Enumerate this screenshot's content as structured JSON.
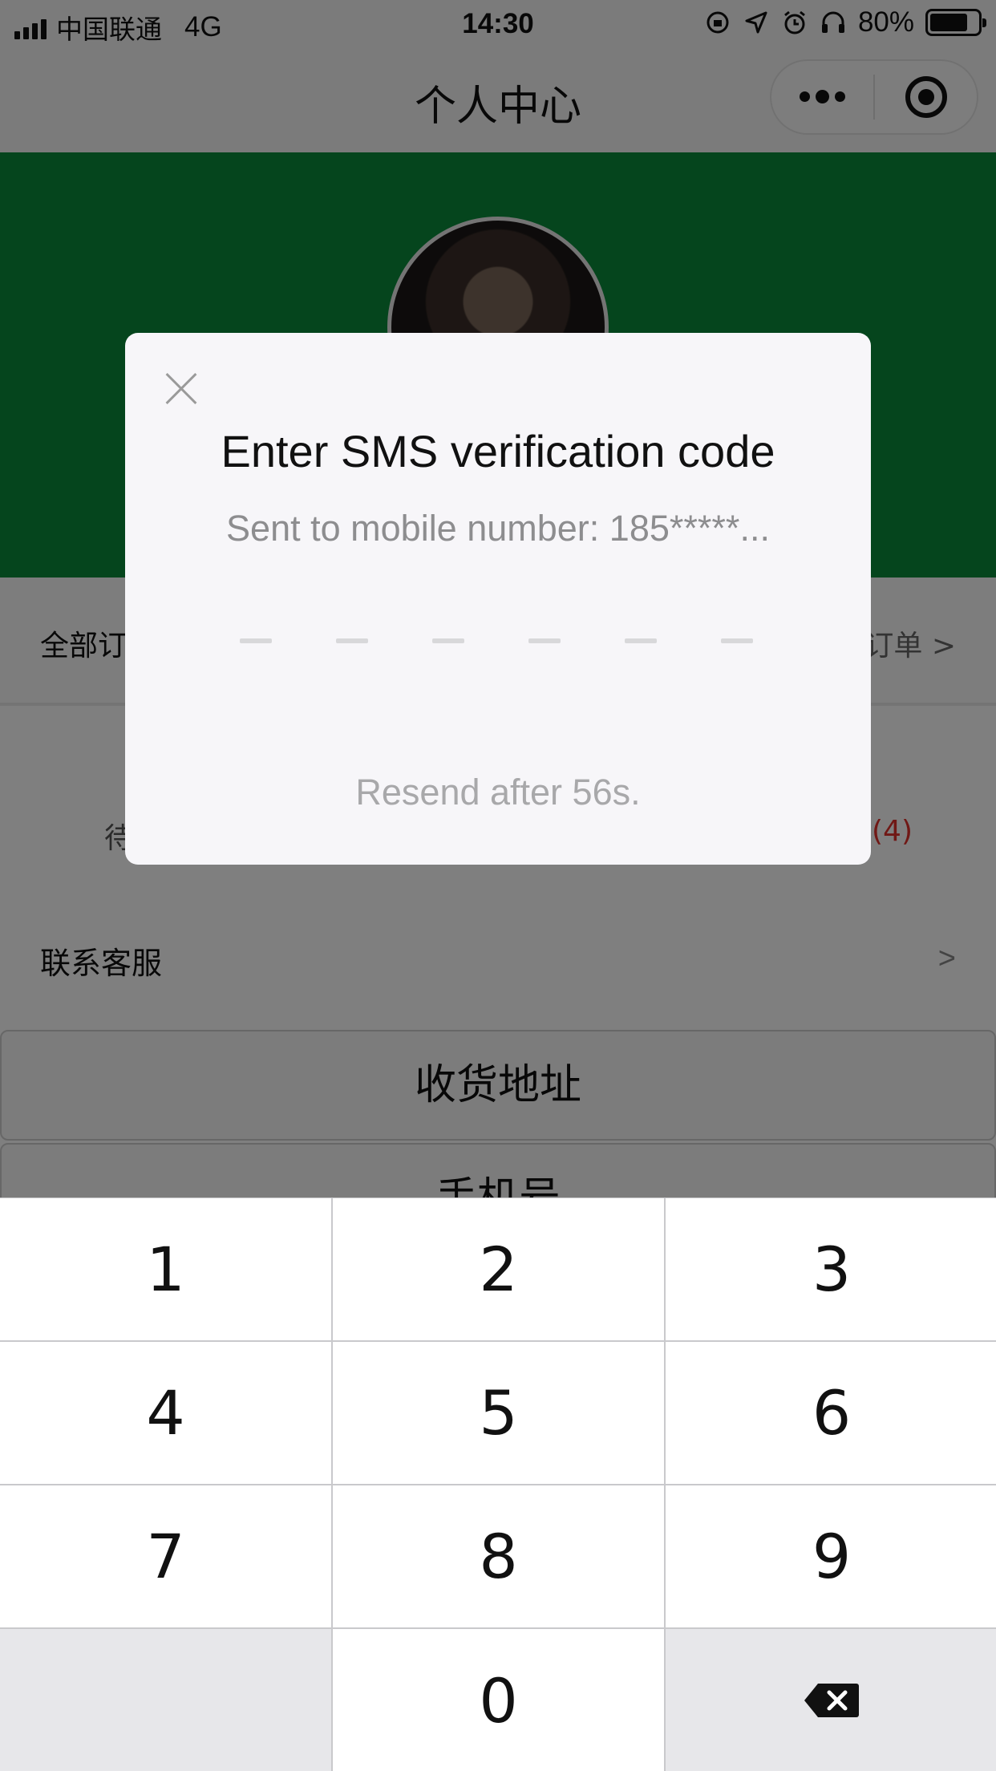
{
  "status_bar": {
    "carrier": "中国联通",
    "network": "4G",
    "time": "14:30",
    "battery": "80%",
    "battery_level": 0.8,
    "icons": [
      "signal-icon",
      "rotation-lock-icon",
      "location-icon",
      "alarm-icon",
      "headphones-icon",
      "battery-icon"
    ]
  },
  "nav": {
    "title": "个人中心",
    "capsule_icons": [
      "more-dots-icon",
      "close-target-icon"
    ]
  },
  "page": {
    "orders_label": "全部订",
    "orders_link": "订单 >",
    "pending_label": "待",
    "badge_count": "(4)",
    "service_label": "联系客服",
    "service_arrow": ">",
    "address_button": "收货地址",
    "phone_button": "手机号"
  },
  "dialog": {
    "title": "Enter SMS verification code",
    "subtitle": "Sent to mobile number: 185*****...",
    "resend": "Resend after 56s.",
    "code_length": 6
  },
  "keypad": {
    "keys": [
      "1",
      "2",
      "3",
      "4",
      "5",
      "6",
      "7",
      "8",
      "9",
      "",
      "0",
      "backspace-icon"
    ]
  },
  "colors": {
    "hero_green": "#0a8a3a",
    "overlay": "rgba(0,0,0,0.5)",
    "badge_red": "#e0302a"
  }
}
